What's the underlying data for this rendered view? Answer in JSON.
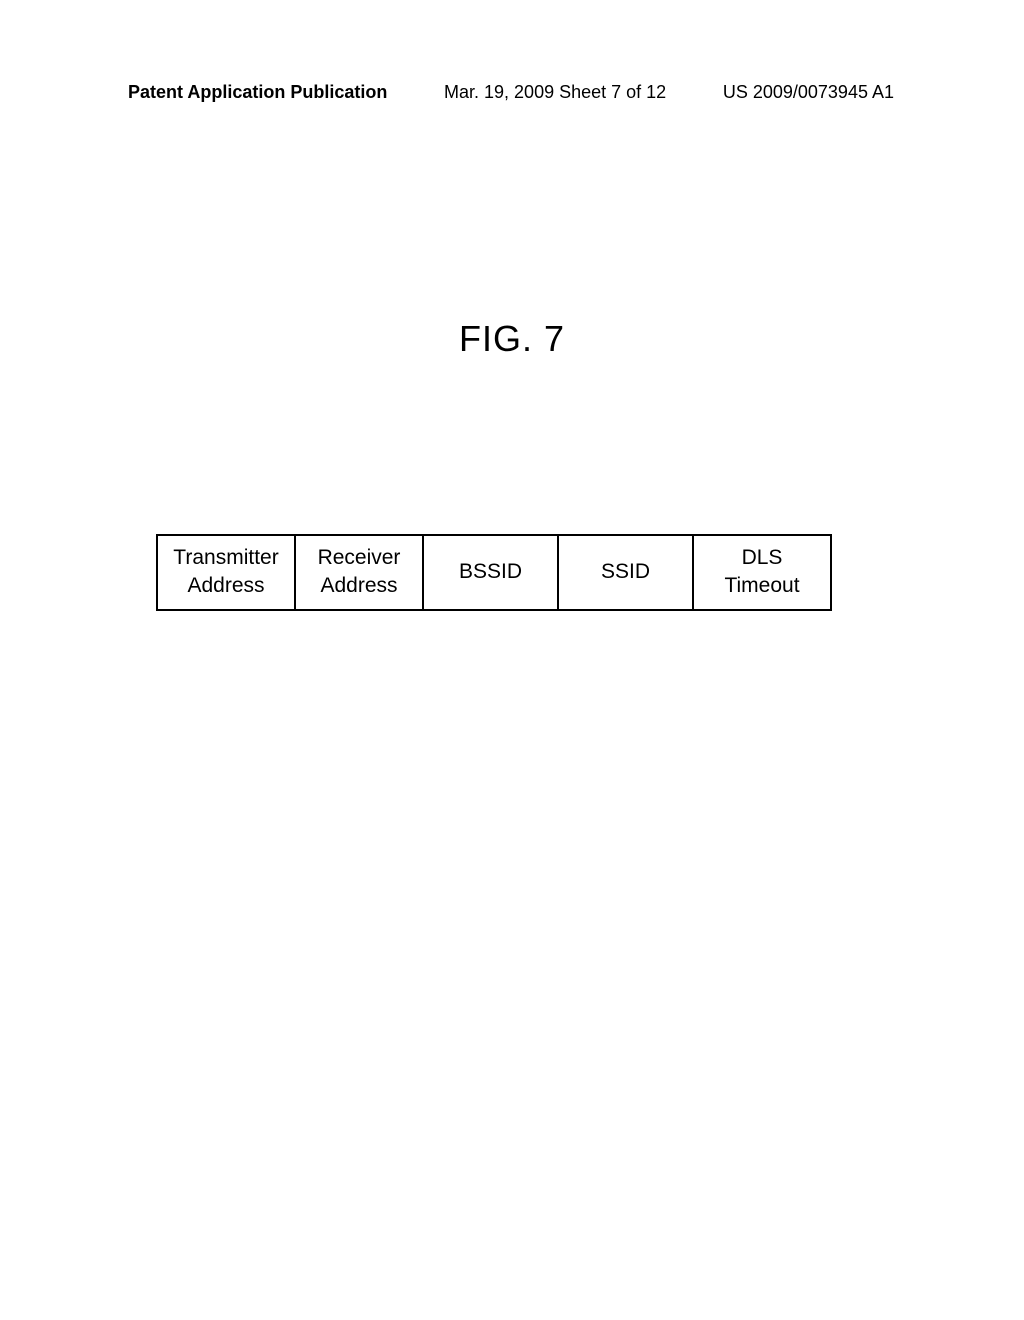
{
  "header": {
    "left": "Patent Application Publication",
    "center": "Mar. 19, 2009  Sheet 7 of 12",
    "right": "US 2009/0073945 A1"
  },
  "figure": {
    "label": "FIG. 7"
  },
  "chart_data": {
    "type": "table",
    "title": "FIG. 7",
    "columns": [
      "Transmitter Address",
      "Receiver Address",
      "BSSID",
      "SSID",
      "DLS Timeout"
    ]
  },
  "table": {
    "cells": {
      "c1_line1": "Transmitter",
      "c1_line2": "Address",
      "c2_line1": "Receiver",
      "c2_line2": "Address",
      "c3": "BSSID",
      "c4": "SSID",
      "c5_line1": "DLS",
      "c5_line2": "Timeout"
    }
  }
}
